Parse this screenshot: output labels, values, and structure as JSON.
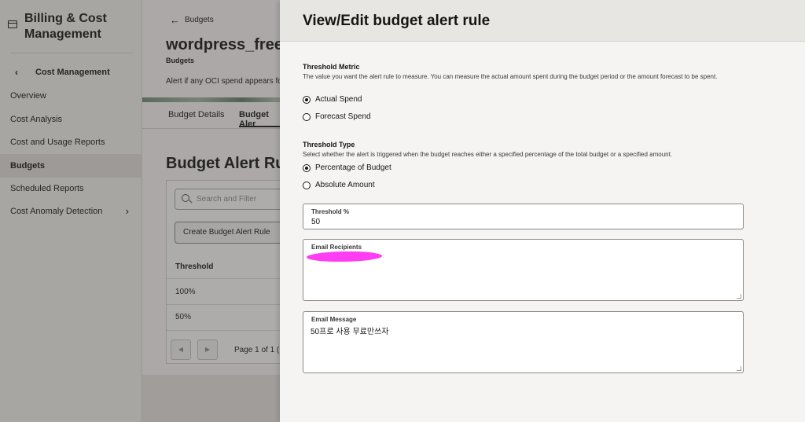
{
  "sidebar": {
    "app_title": "Billing & Cost Management",
    "back_label": "Cost Management",
    "items": [
      {
        "label": "Overview"
      },
      {
        "label": "Cost Analysis"
      },
      {
        "label": "Cost and Usage Reports"
      },
      {
        "label": "Budgets",
        "active": true
      },
      {
        "label": "Scheduled Reports"
      },
      {
        "label": "Cost Anomaly Detection"
      }
    ]
  },
  "main": {
    "breadcrumb": "Budgets",
    "resource_title": "wordpress_free",
    "resource_subtitle": "Budgets",
    "description": "Alert if any OCI spend appears fo",
    "tabs": [
      {
        "label": "Budget Details"
      },
      {
        "label": "Budget Aler",
        "active": true
      }
    ],
    "section_title": "Budget Alert Ru",
    "search_placeholder": "Search and Filter",
    "create_button": "Create Budget Alert Rule",
    "table": {
      "header": "Threshold",
      "rows": [
        "100%",
        "50%"
      ]
    },
    "pager_text": "Page 1 of 1 ("
  },
  "drawer": {
    "title": "View/Edit budget alert rule",
    "threshold_metric": {
      "label": "Threshold Metric",
      "help": "The value you want the alert rule to measure. You can measure the actual amount spent during the budget period or the amount forecast to be spent.",
      "options": [
        {
          "label": "Actual Spend",
          "selected": true
        },
        {
          "label": "Forecast Spend",
          "selected": false
        }
      ]
    },
    "threshold_type": {
      "label": "Threshold Type",
      "help": "Select whether the alert is triggered when the budget reaches either a specified percentage of the total budget or a specified amount.",
      "options": [
        {
          "label": "Percentage of Budget",
          "selected": true
        },
        {
          "label": "Absolute Amount",
          "selected": false
        }
      ]
    },
    "threshold_percent": {
      "label": "Threshold %",
      "value": "50"
    },
    "email_recipients": {
      "label": "Email Recipients",
      "value": ""
    },
    "email_message": {
      "label": "Email Message",
      "value": "50프로 사용 무료만쓰자"
    }
  },
  "colors": {
    "redaction": "#ff3df2",
    "overlay": "#3c3a37",
    "drawer_header": "#e8e6e3"
  }
}
